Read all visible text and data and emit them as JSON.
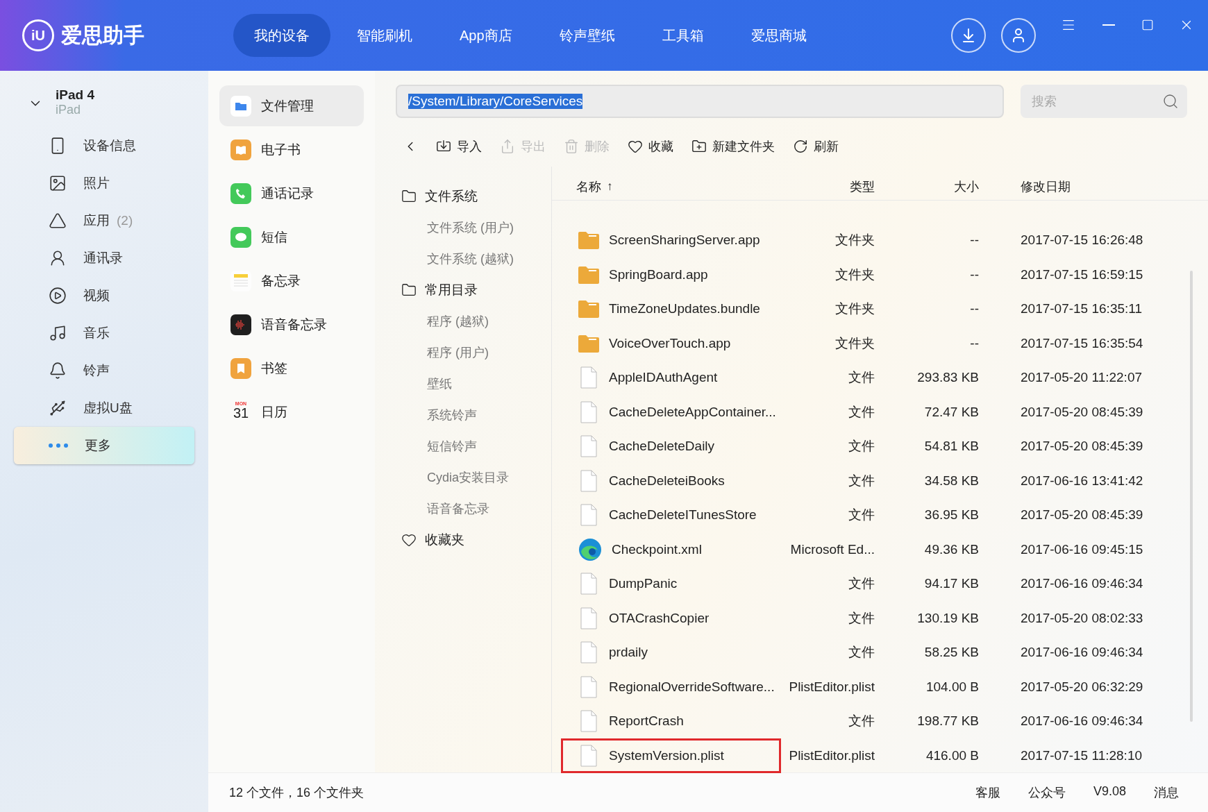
{
  "app": {
    "logo_mark": "iU",
    "name": "爱思助手"
  },
  "nav": [
    {
      "label": "我的设备",
      "selected": true
    },
    {
      "label": "智能刷机",
      "selected": false
    },
    {
      "label": "App商店",
      "selected": false
    },
    {
      "label": "铃声壁纸",
      "selected": false
    },
    {
      "label": "工具箱",
      "selected": false
    },
    {
      "label": "爱思商城",
      "selected": false
    }
  ],
  "device": {
    "name": "iPad 4",
    "model": "iPad",
    "expanded": true
  },
  "sidebar": [
    {
      "kind": "info",
      "label": "设备信息",
      "selected": false
    },
    {
      "kind": "photos",
      "label": "照片",
      "selected": false
    },
    {
      "kind": "apps",
      "label": "应用",
      "count": "(2)",
      "selected": false
    },
    {
      "kind": "contacts",
      "label": "通讯录",
      "selected": false
    },
    {
      "kind": "video",
      "label": "视频",
      "selected": false
    },
    {
      "kind": "music",
      "label": "音乐",
      "selected": false
    },
    {
      "kind": "ringtones",
      "label": "铃声",
      "selected": false
    },
    {
      "kind": "udisk",
      "label": "虚拟U盘",
      "selected": false
    },
    {
      "kind": "more",
      "label": "更多",
      "selected": true
    }
  ],
  "tools": [
    {
      "kind": "files",
      "label": "文件管理",
      "selected": true
    },
    {
      "kind": "books",
      "label": "电子书",
      "selected": false
    },
    {
      "kind": "calls",
      "label": "通话记录",
      "selected": false
    },
    {
      "kind": "messages",
      "label": "短信",
      "selected": false
    },
    {
      "kind": "notes",
      "label": "备忘录",
      "selected": false
    },
    {
      "kind": "voice",
      "label": "语音备忘录",
      "selected": false
    },
    {
      "kind": "bookmarks",
      "label": "书签",
      "selected": false
    },
    {
      "kind": "calendar",
      "label": "日历",
      "icon_day": "MON",
      "icon_date": "31",
      "selected": false
    }
  ],
  "path": {
    "value": "/System/Library/CoreServices",
    "text_selected": true
  },
  "search": {
    "placeholder": "搜索"
  },
  "toolbar": [
    {
      "kind": "import",
      "label": "导入",
      "disabled": false
    },
    {
      "kind": "export",
      "label": "导出",
      "disabled": true
    },
    {
      "kind": "delete",
      "label": "删除",
      "disabled": true
    },
    {
      "kind": "favorite",
      "label": "收藏",
      "disabled": false
    },
    {
      "kind": "new-folder",
      "label": "新建文件夹",
      "disabled": false
    },
    {
      "kind": "refresh",
      "label": "刷新",
      "disabled": false
    }
  ],
  "tree": [
    {
      "kind": "folder",
      "label": "文件系统",
      "children": [
        {
          "label": "文件系统 (用户)"
        },
        {
          "label": "文件系统 (越狱)"
        }
      ]
    },
    {
      "kind": "folder",
      "label": "常用目录",
      "children": [
        {
          "label": "程序 (越狱)"
        },
        {
          "label": "程序 (用户)"
        },
        {
          "label": "壁纸"
        },
        {
          "label": "系统铃声"
        },
        {
          "label": "短信铃声"
        },
        {
          "label": "Cydia安装目录"
        },
        {
          "label": "语音备忘录"
        }
      ]
    },
    {
      "kind": "favorites",
      "label": "收藏夹"
    }
  ],
  "table": {
    "columns": [
      {
        "label": "名称",
        "sort_mark": "↑"
      },
      {
        "label": "类型"
      },
      {
        "label": "大小"
      },
      {
        "label": "修改日期"
      }
    ],
    "rows": [
      {
        "kind": "folder",
        "name": "ScreenSharingServer.app",
        "type": "文件夹",
        "size": "--",
        "date": "2017-07-15 16:26:48",
        "annotated": false
      },
      {
        "kind": "folder",
        "name": "SpringBoard.app",
        "type": "文件夹",
        "size": "--",
        "date": "2017-07-15 16:59:15",
        "annotated": false
      },
      {
        "kind": "folder",
        "name": "TimeZoneUpdates.bundle",
        "type": "文件夹",
        "size": "--",
        "date": "2017-07-15 16:35:11",
        "annotated": false
      },
      {
        "kind": "folder",
        "name": "VoiceOverTouch.app",
        "type": "文件夹",
        "size": "--",
        "date": "2017-07-15 16:35:54",
        "annotated": false
      },
      {
        "kind": "file",
        "name": "AppleIDAuthAgent",
        "type": "文件",
        "size": "293.83 KB",
        "date": "2017-05-20 11:22:07",
        "annotated": false
      },
      {
        "kind": "file",
        "name": "CacheDeleteAppContainer...",
        "type": "文件",
        "size": "72.47 KB",
        "date": "2017-05-20 08:45:39",
        "annotated": false
      },
      {
        "kind": "file",
        "name": "CacheDeleteDaily",
        "type": "文件",
        "size": "54.81 KB",
        "date": "2017-05-20 08:45:39",
        "annotated": false
      },
      {
        "kind": "file",
        "name": "CacheDeleteiBooks",
        "type": "文件",
        "size": "34.58 KB",
        "date": "2017-06-16 13:41:42",
        "annotated": false
      },
      {
        "kind": "file",
        "name": "CacheDeleteITunesStore",
        "type": "文件",
        "size": "36.95 KB",
        "date": "2017-05-20 08:45:39",
        "annotated": false
      },
      {
        "kind": "browser",
        "name": "Checkpoint.xml",
        "type": "Microsoft Ed...",
        "size": "49.36 KB",
        "date": "2017-06-16 09:45:15",
        "annotated": false
      },
      {
        "kind": "file",
        "name": "DumpPanic",
        "type": "文件",
        "size": "94.17 KB",
        "date": "2017-06-16 09:46:34",
        "annotated": false
      },
      {
        "kind": "file",
        "name": "OTACrashCopier",
        "type": "文件",
        "size": "130.19 KB",
        "date": "2017-05-20 08:02:33",
        "annotated": false
      },
      {
        "kind": "file",
        "name": "prdaily",
        "type": "文件",
        "size": "58.25 KB",
        "date": "2017-06-16 09:46:34",
        "annotated": false
      },
      {
        "kind": "file",
        "name": "RegionalOverrideSoftware...",
        "type": "PlistEditor.plist",
        "size": "104.00 B",
        "date": "2017-05-20 06:32:29",
        "annotated": false
      },
      {
        "kind": "file",
        "name": "ReportCrash",
        "type": "文件",
        "size": "198.77 KB",
        "date": "2017-06-16 09:46:34",
        "annotated": false
      },
      {
        "kind": "file",
        "name": "SystemVersion.plist",
        "type": "PlistEditor.plist",
        "size": "416.00 B",
        "date": "2017-07-15 11:28:10",
        "annotated": true
      }
    ]
  },
  "status": {
    "summary": "12 个文件，16 个文件夹",
    "links": [
      "客服",
      "公众号",
      "V9.08",
      "消息"
    ]
  }
}
